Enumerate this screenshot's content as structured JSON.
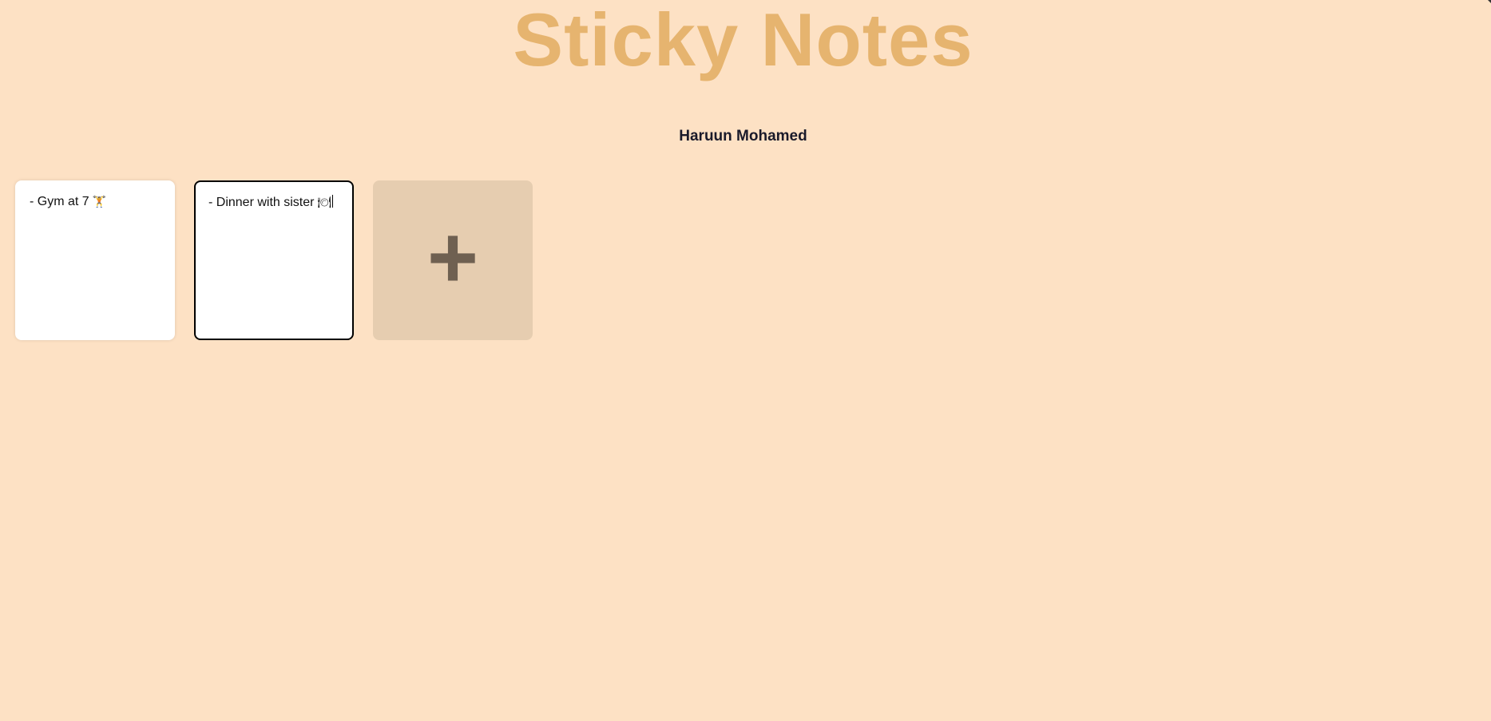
{
  "header": {
    "title": "Sticky Notes",
    "user_name": "Haruun Mohamed"
  },
  "notes": [
    {
      "text": "- Gym at 7",
      "emoji": "🏋",
      "emoji_icon": "weightlifting-icon",
      "active": false
    },
    {
      "text": "- Dinner with sister",
      "emoji": "🍽",
      "emoji_icon": "plate-icon",
      "active": true
    }
  ],
  "add_button": {
    "label": "+",
    "icon": "plus-icon"
  },
  "colors": {
    "background": "#fde1c4",
    "title": "#e6b46f",
    "add_button_bg": "#e6cdb0",
    "plus": "#6f6051"
  }
}
